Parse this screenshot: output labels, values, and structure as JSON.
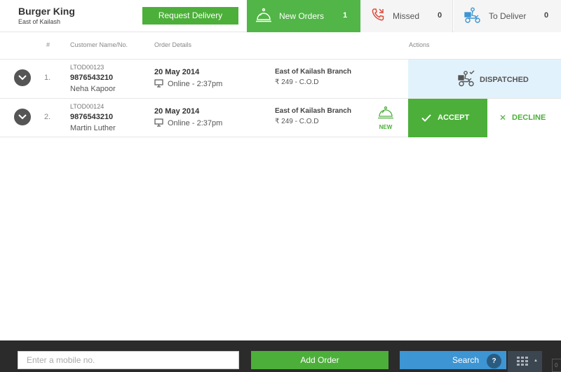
{
  "header": {
    "brand_name": "Burger King",
    "brand_location": "East of Kailash",
    "request_delivery_label": "Request Delivery"
  },
  "tabs": [
    {
      "label": "New Orders",
      "count": "1",
      "icon": "cloche-icon",
      "active": true
    },
    {
      "label": "Missed",
      "count": "0",
      "icon": "missed-call-icon",
      "active": false
    },
    {
      "label": "To Deliver",
      "count": "0",
      "icon": "delivery-scooter-icon",
      "active": false
    }
  ],
  "columns": {
    "index": "#",
    "customer": "Customer Name/No.",
    "details": "Order Details",
    "actions": "Actions"
  },
  "orders": [
    {
      "index": "1.",
      "order_id": "LTOD00123",
      "phone": "9876543210",
      "name": "Neha Kapoor",
      "date": "20 May 2014",
      "mode": "Online - 2:37pm",
      "branch": "East of Kailash Branch",
      "price": "₹ 249 - C.O.D",
      "status": "DISPATCHED"
    },
    {
      "index": "2.",
      "order_id": "LTOD00124",
      "phone": "9876543210",
      "name": "Martin Luther",
      "date": "20 May 2014",
      "mode": "Online - 2:37pm",
      "branch": "East of Kailash Branch",
      "price": "₹ 249 - C.O.D",
      "badge": "NEW",
      "accept_label": "ACCEPT",
      "decline_label": "DECLINE"
    }
  ],
  "bottom": {
    "mobile_placeholder": "Enter a mobile no.",
    "add_order_label": "Add Order",
    "search_label": "Search",
    "help_label": "?",
    "corner_text": "0"
  },
  "colors": {
    "green": "#4caf3a",
    "active_tab": "#52b547",
    "blue": "#3d95d3",
    "dispatched_bg": "#e2f2fc",
    "bottom_bar": "#2b2b2b"
  }
}
